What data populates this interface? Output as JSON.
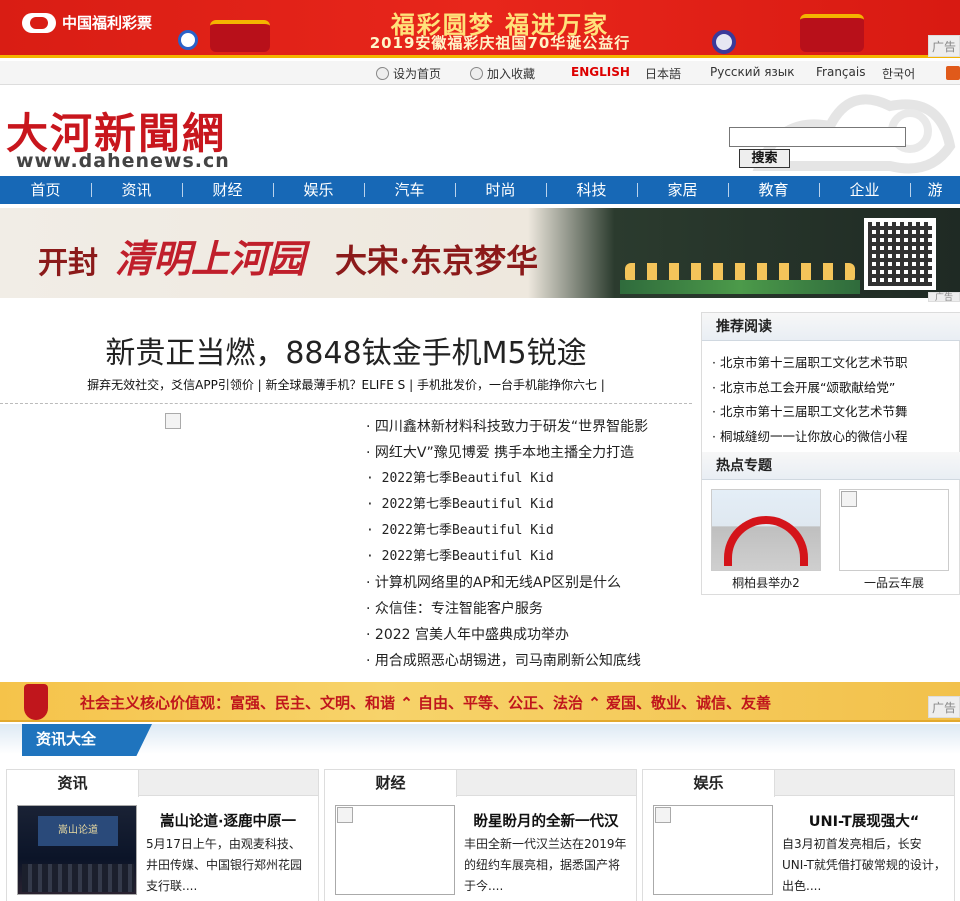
{
  "top_banner": {
    "logo": "中国福利彩票",
    "headline": "福彩圆梦 福进万家",
    "sub": "2019安徽福彩庆祖国70华诞公益行",
    "ad": "广告"
  },
  "langbar": {
    "set_home": "设为首页",
    "add_favorite": "加入收藏",
    "languages": [
      "ENGLISH",
      "日本語",
      "Русский язык",
      "Français",
      "한국어"
    ]
  },
  "masthead": {
    "logo_cn": "大河新聞網",
    "logo_url": "www.dahenews.cn",
    "search_button": "搜索",
    "search_value": ""
  },
  "nav": [
    "首页",
    "资讯",
    "财经",
    "娱乐",
    "汽车",
    "时尚",
    "科技",
    "家居",
    "教育",
    "企业",
    "游"
  ],
  "kf_banner": {
    "t1": "开封",
    "t2": "清明上河园",
    "t3": "大宋·东京梦华",
    "ad": "广告"
  },
  "headline": {
    "title": "新贵正当燃，8848钛金手机M5锐途",
    "sub_links": [
      "摒弃无效社交，爻信APP引领价",
      "新全球最薄手机？ELIFE S",
      "手机批发价，一台手机能挣你六七"
    ]
  },
  "news_list": [
    "四川鑫林新材料科技致力于研发“世界智能影",
    "网红大V”豫见博爱 携手本地主播全力打造",
    "2022第七季Beautiful Kid",
    "2022第七季Beautiful Kid",
    "2022第七季Beautiful Kid",
    "2022第七季Beautiful Kid",
    "计算机网络里的AP和无线AP区别是什么",
    "众信佳：专注智能客户服务",
    "2022 宫美人年中盛典成功举办",
    "用合成照恶心胡锡进，司马南刷新公知底线"
  ],
  "sidebar": {
    "recommend_title": "推荐阅读",
    "recommend": [
      "北京市第十三届职工文化艺术节职",
      "北京市总工会开展“颂歌献给党”",
      "北京市第十三届职工文化艺术节舞",
      "桐城缝纫一一让你放心的微信小程"
    ],
    "topics_title": "热点专题",
    "topics": [
      "桐柏县举办2",
      "一品云车展"
    ]
  },
  "values_banner": "社会主义核心价值观：富强、民主、文明、和谐 ⌃ 自由、平等、公正、法治 ⌃ 爱国、敬业、诚信、友善",
  "values_ad": "广告",
  "section_title": "资讯大全",
  "columns": [
    {
      "tab": "资讯",
      "title": "嵩山论道·逐鹿中原一",
      "desc": "5月17日上午，由观麦科技、井田传媒、中国银行郑州花园支行联...."
    },
    {
      "tab": "财经",
      "title": "盼星盼月的全新一代汉",
      "desc": "丰田全新一代汉兰达在2019年的纽约车展亮相，据悉国产将于今...."
    },
    {
      "tab": "娱乐",
      "title": "UNI-T展现强大“",
      "desc": "自3月初首发亮相后，长安UNI-T就凭借打破常规的设计，出色...."
    }
  ],
  "colors": {
    "nav_blue": "#1768b6",
    "brand_red": "#c8161d",
    "banner_red": "#d91d14"
  }
}
